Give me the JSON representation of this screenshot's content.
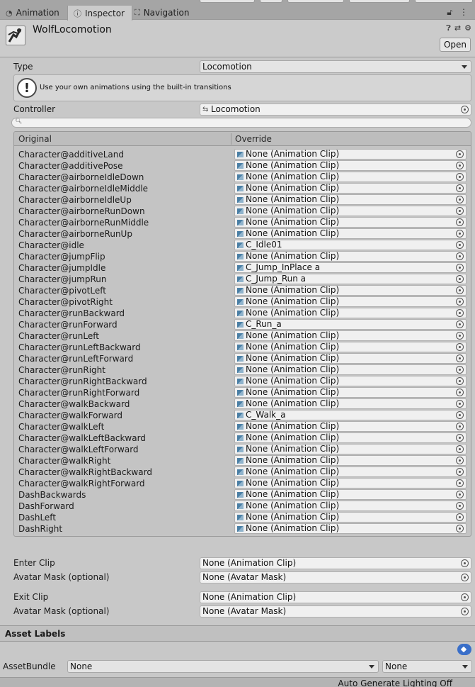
{
  "tabs": [
    {
      "label": "Animation",
      "icon": "clock-icon"
    },
    {
      "label": "Inspector",
      "icon": "info-icon"
    },
    {
      "label": "Navigation",
      "icon": "navigation-icon"
    }
  ],
  "asset": {
    "name": "WolfLocomotion",
    "open_label": "Open"
  },
  "type_row": {
    "label": "Type",
    "value": "Locomotion"
  },
  "helpbox": {
    "message": "Use your own animations using the built-in transitions"
  },
  "controller": {
    "label": "Controller",
    "value": "Locomotion"
  },
  "table": {
    "header_original": "Original",
    "header_override": "Override",
    "rows": [
      {
        "original": "Character@additiveLand",
        "override": "None (Animation Clip)"
      },
      {
        "original": "Character@additivePose",
        "override": "None (Animation Clip)"
      },
      {
        "original": "Character@airborneIdleDown",
        "override": "None (Animation Clip)"
      },
      {
        "original": "Character@airborneIdleMiddle",
        "override": "None (Animation Clip)"
      },
      {
        "original": "Character@airborneIdleUp",
        "override": "None (Animation Clip)"
      },
      {
        "original": "Character@airborneRunDown",
        "override": "None (Animation Clip)"
      },
      {
        "original": "Character@airborneRunMiddle",
        "override": "None (Animation Clip)"
      },
      {
        "original": "Character@airborneRunUp",
        "override": "None (Animation Clip)"
      },
      {
        "original": "Character@idle",
        "override": "C_Idle01"
      },
      {
        "original": "Character@jumpFlip",
        "override": "None (Animation Clip)"
      },
      {
        "original": "Character@jumpIdle",
        "override": "C_Jump_InPlace a"
      },
      {
        "original": "Character@jumpRun",
        "override": "C_Jump_Run a"
      },
      {
        "original": "Character@pivotLeft",
        "override": "None (Animation Clip)"
      },
      {
        "original": "Character@pivotRight",
        "override": "None (Animation Clip)"
      },
      {
        "original": "Character@runBackward",
        "override": "None (Animation Clip)"
      },
      {
        "original": "Character@runForward",
        "override": "C_Run_a"
      },
      {
        "original": "Character@runLeft",
        "override": "None (Animation Clip)"
      },
      {
        "original": "Character@runLeftBackward",
        "override": "None (Animation Clip)"
      },
      {
        "original": "Character@runLeftForward",
        "override": "None (Animation Clip)"
      },
      {
        "original": "Character@runRight",
        "override": "None (Animation Clip)"
      },
      {
        "original": "Character@runRightBackward",
        "override": "None (Animation Clip)"
      },
      {
        "original": "Character@runRightForward",
        "override": "None (Animation Clip)"
      },
      {
        "original": "Character@walkBackward",
        "override": "None (Animation Clip)"
      },
      {
        "original": "Character@walkForward",
        "override": "C_Walk_a"
      },
      {
        "original": "Character@walkLeft",
        "override": "None (Animation Clip)"
      },
      {
        "original": "Character@walkLeftBackward",
        "override": "None (Animation Clip)"
      },
      {
        "original": "Character@walkLeftForward",
        "override": "None (Animation Clip)"
      },
      {
        "original": "Character@walkRight",
        "override": "None (Animation Clip)"
      },
      {
        "original": "Character@walkRightBackward",
        "override": "None (Animation Clip)"
      },
      {
        "original": "Character@walkRightForward",
        "override": "None (Animation Clip)"
      },
      {
        "original": "DashBackwards",
        "override": "None (Animation Clip)"
      },
      {
        "original": "DashForward",
        "override": "None (Animation Clip)"
      },
      {
        "original": "DashLeft",
        "override": "None (Animation Clip)"
      },
      {
        "original": "DashRight",
        "override": "None (Animation Clip)"
      }
    ]
  },
  "enter_clip": {
    "label": "Enter Clip",
    "value": "None (Animation Clip)"
  },
  "enter_mask": {
    "label": "Avatar Mask (optional)",
    "value": "None (Avatar Mask)"
  },
  "exit_clip": {
    "label": "Exit Clip",
    "value": "None (Animation Clip)"
  },
  "exit_mask": {
    "label": "Avatar Mask (optional)",
    "value": "None (Avatar Mask)"
  },
  "asset_labels": {
    "title": "Asset Labels"
  },
  "asset_bundle": {
    "label": "AssetBundle",
    "name_value": "None",
    "variant_value": "None"
  },
  "status_bar": {
    "text": "Auto Generate Lighting Off"
  },
  "colors": {
    "tag_accent": "#3a6fc9",
    "clip_icon": "#4a7fa5"
  }
}
